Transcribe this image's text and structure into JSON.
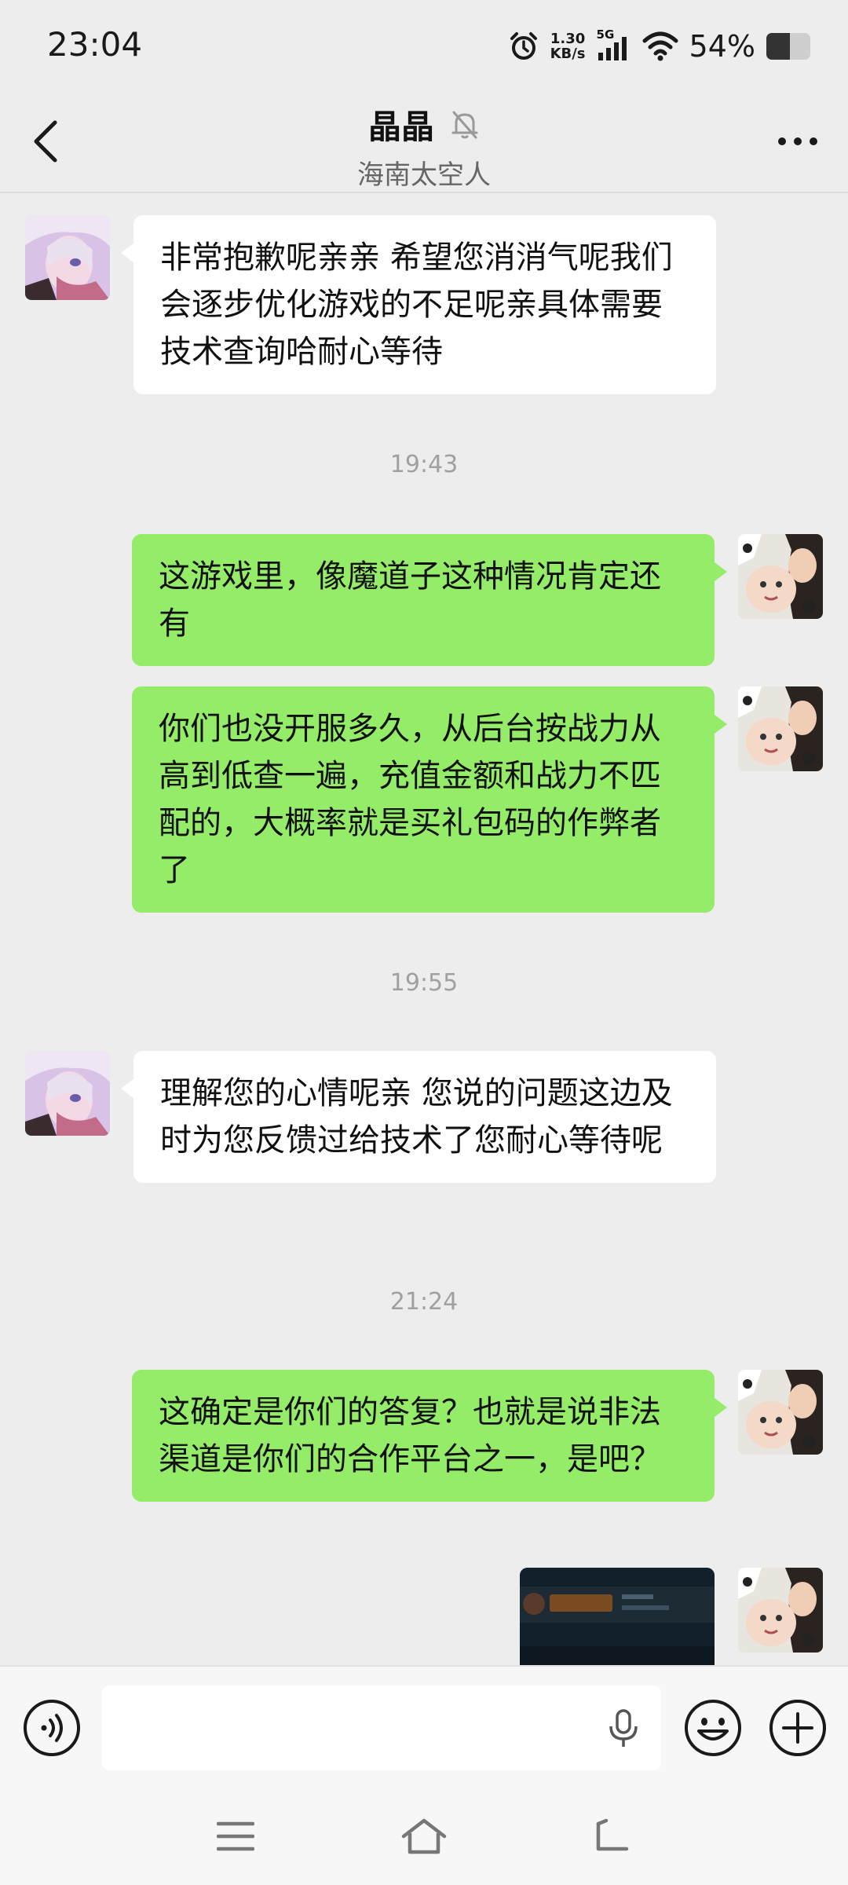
{
  "status_bar": {
    "time": "23:04",
    "net_speed_value": "1.30",
    "net_speed_unit": "KB/s",
    "network": "5G",
    "battery_text": "54%",
    "battery_level": 0.54
  },
  "header": {
    "title": "晶晶",
    "subtitle": "海南太空人",
    "mute_icon": "bell-off-icon",
    "more_icon": "more-icon"
  },
  "messages": [
    {
      "side": "in",
      "text": "非常抱歉呢亲亲 希望您消消气呢我们会逐步优化游戏的不足呢亲具体需要技术查询哈耐心等待"
    },
    {
      "timestamp": "19:43"
    },
    {
      "side": "out",
      "text": "这游戏里，像魔道子这种情况肯定还有"
    },
    {
      "side": "out",
      "text": "你们也没开服多久，从后台按战力从高到低查一遍，充值金额和战力不匹配的，大概率就是买礼包码的作弊者了"
    },
    {
      "timestamp": "19:55"
    },
    {
      "side": "in",
      "text": "理解您的心情呢亲 您说的问题这边及时为您反馈过给技术了您耐心等待呢"
    },
    {
      "timestamp": "21:24"
    },
    {
      "side": "out",
      "text": "这确定是你们的答复？也就是说非法渠道是你们的合作平台之一，是吧？"
    },
    {
      "side": "out",
      "type": "image"
    }
  ],
  "input_bar": {
    "voice_icon": "voice-icon",
    "mic_icon": "microphone-icon",
    "emoji_icon": "emoji-icon",
    "plus_icon": "plus-icon"
  },
  "nav_bar": {
    "menu_icon": "menu-icon",
    "home_icon": "home-icon",
    "back_icon": "back-icon"
  }
}
